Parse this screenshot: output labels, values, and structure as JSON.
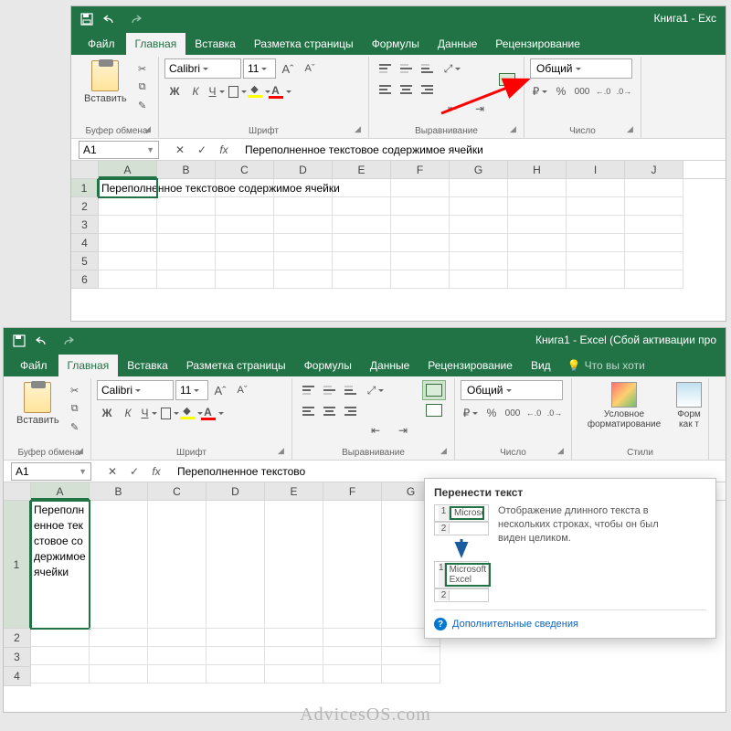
{
  "window1": {
    "title": "Книга1 - Exc",
    "tabs": {
      "file": "Файл",
      "home": "Главная",
      "insert": "Вставка",
      "layout": "Разметка страницы",
      "formulas": "Формулы",
      "data": "Данные",
      "review": "Рецензирование"
    },
    "ribbon": {
      "clipboard": {
        "paste": "Вставить",
        "label": "Буфер обмена"
      },
      "font": {
        "name": "Calibri",
        "size": "11",
        "bold": "Ж",
        "italic": "К",
        "underline": "Ч",
        "label": "Шрифт"
      },
      "alignment": {
        "label": "Выравнивание"
      },
      "number": {
        "format": "Общий",
        "label": "Число"
      }
    },
    "nameBox": "A1",
    "formula": "Переполненное текстовое содержимое ячейки",
    "columns": [
      "A",
      "B",
      "C",
      "D",
      "E",
      "F",
      "G",
      "H",
      "I",
      "J"
    ],
    "rowNums": [
      "1",
      "2",
      "3",
      "4",
      "5",
      "6"
    ],
    "cellA1": "Переполненное текстовое содержимое ячейки"
  },
  "window2": {
    "title": "Книга1 - Excel (Сбой активации про",
    "tabs": {
      "file": "Файл",
      "home": "Главная",
      "insert": "Вставка",
      "layout": "Разметка страницы",
      "formulas": "Формулы",
      "data": "Данные",
      "review": "Рецензирование",
      "view": "Вид",
      "tellme": "Что вы хоти"
    },
    "ribbon": {
      "clipboard": {
        "paste": "Вставить",
        "label": "Буфер обмена"
      },
      "font": {
        "name": "Calibri",
        "size": "11",
        "bold": "Ж",
        "italic": "К",
        "underline": "Ч",
        "label": "Шрифт"
      },
      "alignment": {
        "label": "Выравнивание"
      },
      "number": {
        "format": "Общий",
        "label": "Число"
      },
      "styles": {
        "cond": "Условное форматирование",
        "format_as": "Форм как т",
        "label": "Стили"
      }
    },
    "nameBox": "A1",
    "formula": "Переполненное текстово",
    "columns": [
      "A",
      "B",
      "C",
      "D",
      "E",
      "F",
      "G"
    ],
    "rowNums": [
      "1",
      "2",
      "3",
      "4"
    ],
    "cellA1": "Переполненное текстовое содержимое ячейки",
    "tooltip": {
      "title": "Перенести текст",
      "ex1": "Microsoft E",
      "ex2": "Microsoft Excel",
      "text": "Отображение длинного текста в нескольких строках, чтобы он был виден целиком.",
      "link": "Дополнительные сведения"
    }
  },
  "watermark": "AdvicesOS.com"
}
